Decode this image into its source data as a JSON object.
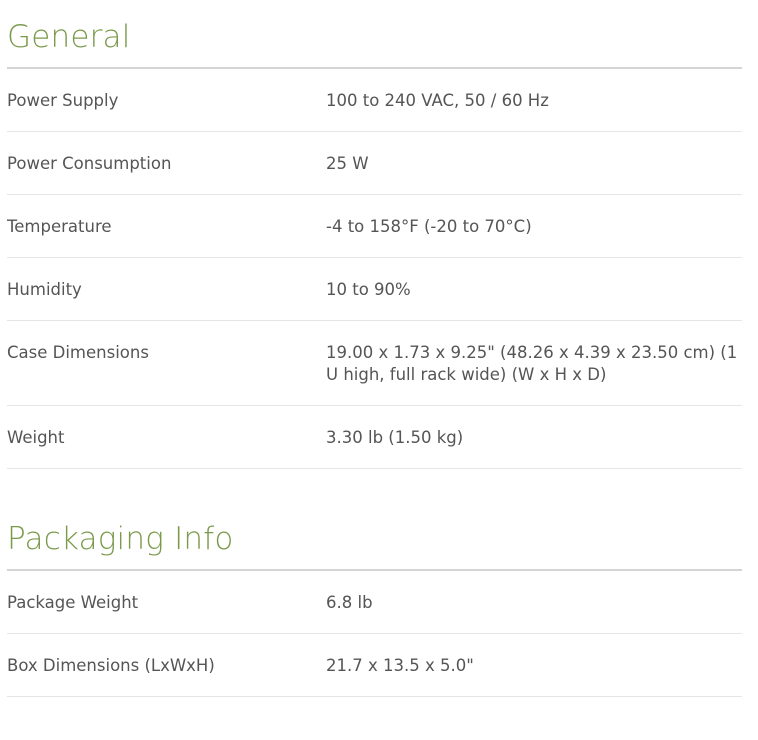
{
  "general": {
    "title": "General",
    "rows": [
      {
        "label": "Power Supply",
        "value": "100 to 240 VAC, 50 / 60 Hz"
      },
      {
        "label": "Power Consumption",
        "value": "25 W"
      },
      {
        "label": "Temperature",
        "value": "-4 to 158°F (-20 to 70°C)"
      },
      {
        "label": "Humidity",
        "value": "10 to 90%"
      },
      {
        "label": "Case Dimensions",
        "value": "19.00 x 1.73 x 9.25\" (48.26 x 4.39 x 23.50 cm) (1 U high, full rack wide) (W x H x D)"
      },
      {
        "label": "Weight",
        "value": "3.30 lb (1.50 kg)"
      }
    ]
  },
  "packaging": {
    "title": "Packaging Info",
    "rows": [
      {
        "label": "Package Weight",
        "value": "6.8 lb"
      },
      {
        "label": "Box Dimensions (LxWxH)",
        "value": "21.7 x 13.5 x 5.0\""
      }
    ]
  },
  "colors": {
    "heading": "#7a9a4a",
    "text": "#555555",
    "heading_rule": "#d4d4d4",
    "row_rule": "#e6e6e6"
  }
}
